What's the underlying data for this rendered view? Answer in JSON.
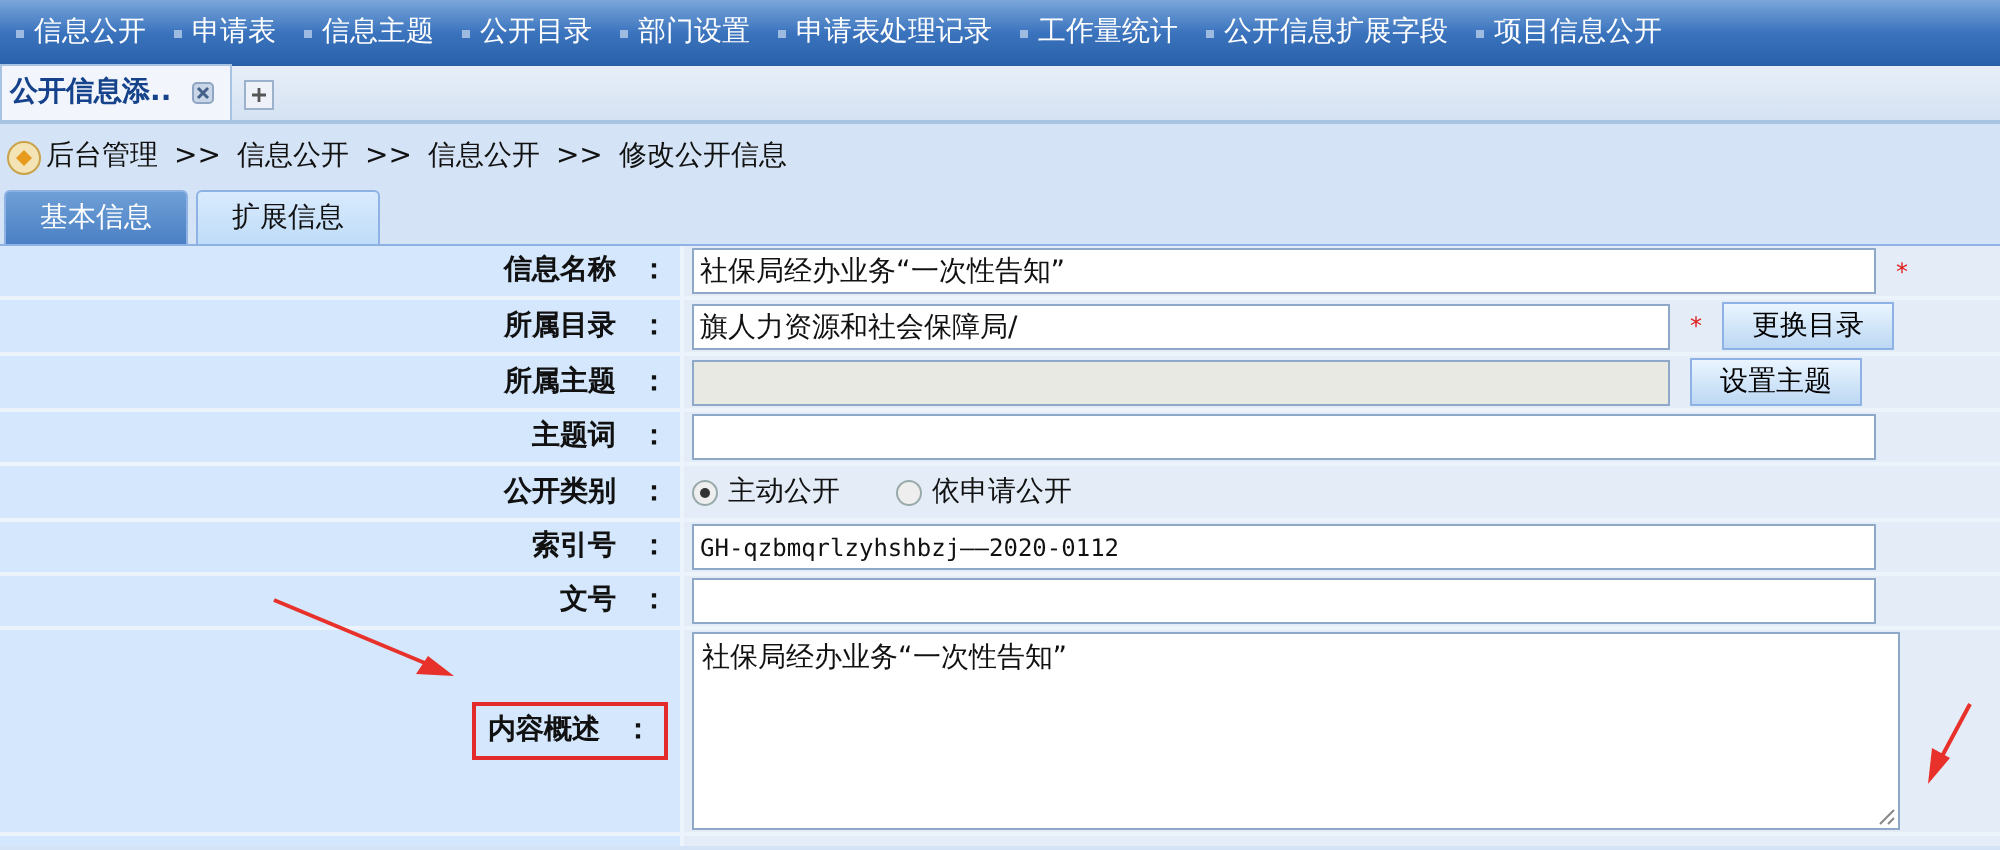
{
  "top_menu": [
    "信息公开",
    "申请表",
    "信息主题",
    "公开目录",
    "部门设置",
    "申请表处理记录",
    "工作量统计",
    "公开信息扩展字段",
    "项目信息公开"
  ],
  "page_tabs": [
    {
      "label": "公开信息添..",
      "selected": true
    }
  ],
  "breadcrumb": [
    "后台管理",
    ">>",
    "信息公开",
    ">>",
    "信息公开",
    ">>",
    "修改公开信息"
  ],
  "form_tabs": [
    {
      "label": "基本信息",
      "selected": true
    },
    {
      "label": "扩展信息",
      "selected": false
    }
  ],
  "fields": [
    {
      "kind": "text",
      "label": "信息名称",
      "colon": "：",
      "value": "社保局经办业务“一次性告知”",
      "required": "*"
    },
    {
      "kind": "text",
      "label": "所属目录",
      "colon": "：",
      "value": "旗人力资源和社会保障局/",
      "required": "*",
      "button": "更换目录"
    },
    {
      "kind": "text",
      "label": "所属主题",
      "colon": "：",
      "disabled": true,
      "button": "设置主题"
    },
    {
      "kind": "text",
      "label": "主题词",
      "colon": "："
    },
    {
      "kind": "radio",
      "label": "公开类别",
      "colon": "：",
      "options": [
        {
          "label": "主动公开",
          "selected": true
        },
        {
          "label": "依申请公开",
          "selected": false
        }
      ]
    },
    {
      "kind": "text",
      "label": "索引号",
      "colon": "：",
      "value": "GH-qzbmqrlzyhshbzj——2020-0112",
      "mono": true
    },
    {
      "kind": "text",
      "label": "文号",
      "colon": "："
    },
    {
      "kind": "textarea",
      "label": "内容概述",
      "colon": "：",
      "value": "社保局经办业务“一次性告知”",
      "highlighted": true
    }
  ]
}
